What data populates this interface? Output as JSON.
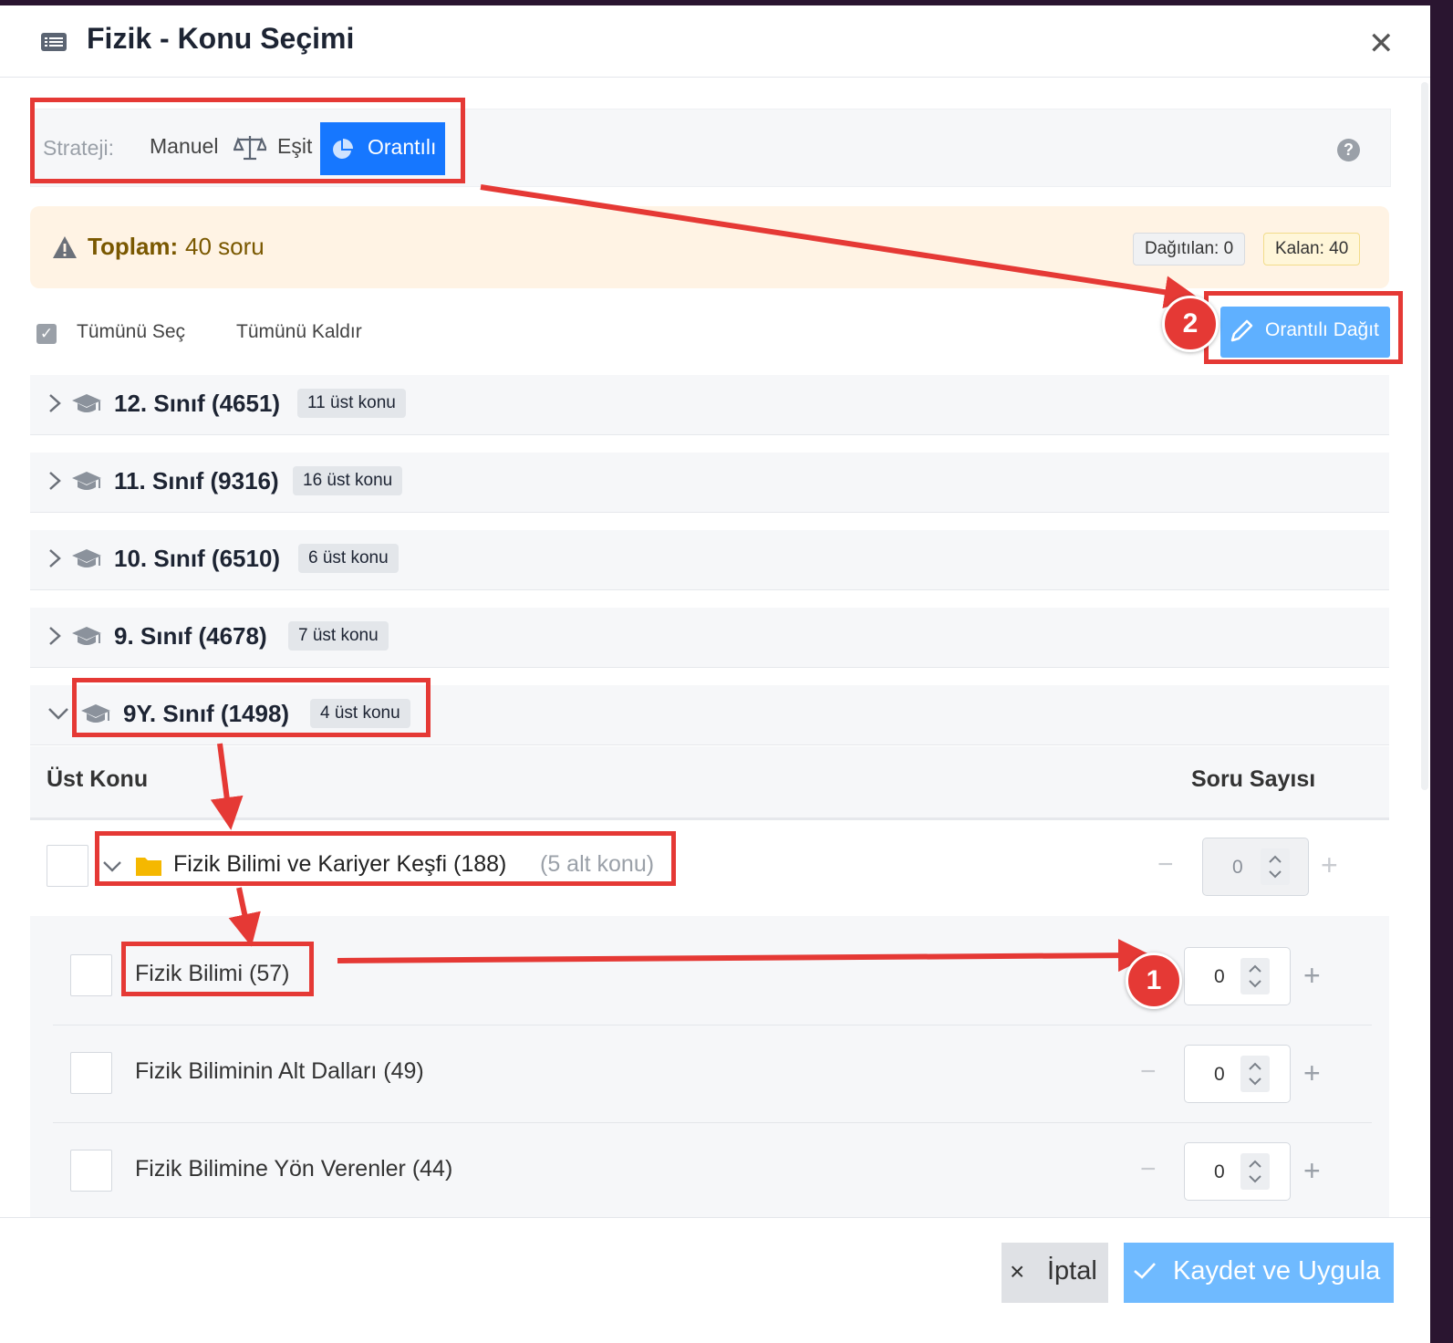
{
  "header": {
    "title": "Fizik - Konu Seçimi",
    "icon": "list-icon",
    "close_icon": "close-icon"
  },
  "strategy": {
    "label": "Strateji:",
    "options": [
      {
        "label": "Manuel"
      },
      {
        "label": "Eşit",
        "icon": "scale-icon"
      },
      {
        "label": "Orantılı",
        "icon": "pie-chart-icon",
        "selected": true
      }
    ],
    "help": "?"
  },
  "summary": {
    "total_key": "Toplam:",
    "total_value": "40 soru",
    "distributed": "Dağıtılan: 0",
    "remaining": "Kalan: 40"
  },
  "selection": {
    "select_all": "Tümünü Seç",
    "clear_all": "Tümünü Kaldır",
    "distribute_button": "Orantılı Dağıt"
  },
  "grades": [
    {
      "title": "12. Sınıf (4651)",
      "badge": "11 üst konu",
      "expanded": false
    },
    {
      "title": "11. Sınıf (9316)",
      "badge": "16 üst konu",
      "expanded": false
    },
    {
      "title": "10. Sınıf (6510)",
      "badge": "6 üst konu",
      "expanded": false
    },
    {
      "title": "9. Sınıf (4678)",
      "badge": "7 üst konu",
      "expanded": false
    },
    {
      "title": "9Y. Sınıf (1498)",
      "badge": "4 üst konu",
      "expanded": true
    }
  ],
  "table": {
    "col_topic": "Üst Konu",
    "col_count": "Soru Sayısı"
  },
  "topic": {
    "title": "Fizik Bilimi ve Kariyer Keşfi (188)",
    "sub_count": "(5 alt konu)",
    "value": "0",
    "minus": "−",
    "plus": "+"
  },
  "subtopics": [
    {
      "title": "Fizik Bilimi (57)",
      "value": "0"
    },
    {
      "title": "Fizik Biliminin Alt Dalları (49)",
      "value": "0"
    },
    {
      "title": "Fizik Bilimine Yön Verenler (44)",
      "value": "0"
    }
  ],
  "footer": {
    "cancel": "İptal",
    "cancel_icon": "×",
    "save": "Kaydet ve Uygula"
  },
  "annotations": {
    "marker_1": "1",
    "marker_2": "2",
    "color": "#e53935"
  },
  "colors": {
    "primary": "#1677ff",
    "primary_light": "#5fb0ff",
    "warning_bg": "#fff3e4",
    "warning_text": "#7a5800"
  }
}
